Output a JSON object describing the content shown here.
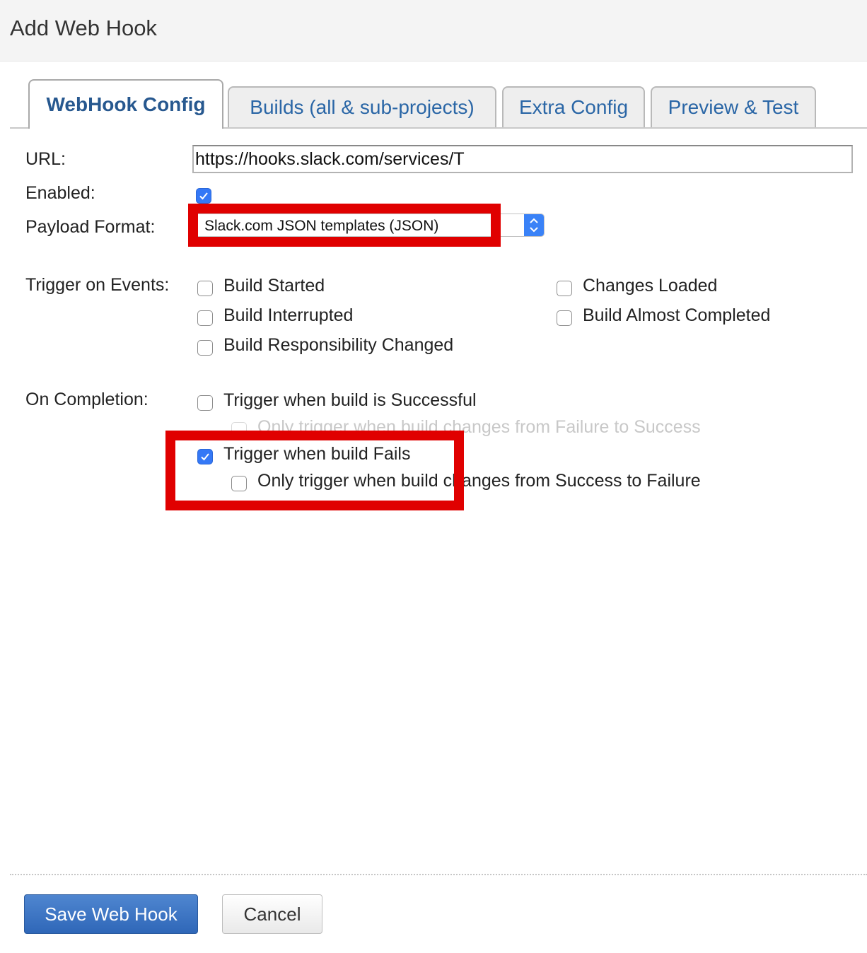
{
  "dialog": {
    "title": "Add Web Hook"
  },
  "tabs": [
    {
      "label": "WebHook Config",
      "active": true
    },
    {
      "label": "Builds (all & sub-projects)",
      "active": false
    },
    {
      "label": "Extra Config",
      "active": false
    },
    {
      "label": "Preview & Test",
      "active": false
    }
  ],
  "form": {
    "url_label": "URL:",
    "url_value": "https://hooks.slack.com/services/T",
    "enabled_label": "Enabled:",
    "enabled_checked": true,
    "payload_label": "Payload Format:",
    "payload_value": "Slack.com JSON templates (JSON)",
    "trigger_label": "Trigger on Events:",
    "events": [
      {
        "label": "Build Started",
        "checked": false
      },
      {
        "label": "Changes Loaded",
        "checked": false
      },
      {
        "label": "Build Interrupted",
        "checked": false
      },
      {
        "label": "Build Almost Completed",
        "checked": false
      },
      {
        "label": "Build Responsibility Changed",
        "checked": false
      }
    ],
    "completion_label": "On Completion:",
    "completion": [
      {
        "label": "Trigger when build is Successful",
        "checked": false,
        "enabled": true
      },
      {
        "label": "Only trigger when build changes from Failure to Success",
        "checked": false,
        "enabled": false
      },
      {
        "label": "Trigger when build Fails",
        "checked": true,
        "enabled": true
      },
      {
        "label": "Only trigger when build changes from Success to Failure",
        "checked": false,
        "enabled": true
      }
    ]
  },
  "buttons": {
    "save": "Save Web Hook",
    "cancel": "Cancel"
  },
  "colors": {
    "highlight": "#e00000",
    "checkbox_checked": "#3478f6",
    "tab_text": "#2a66a6",
    "primary_button": "#3a72c4"
  }
}
